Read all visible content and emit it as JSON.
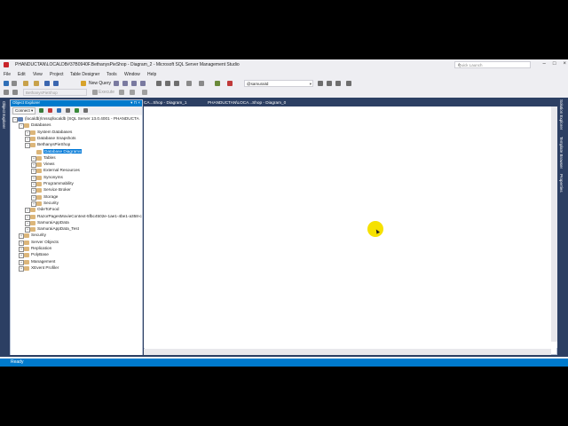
{
  "window": {
    "title": "PHANDUCTAN\\LOCALDB#37B0940F.BethanysPieShop - Diagram_2 - Microsoft SQL Server Management Studio",
    "quick_launch_placeholder": "Quick Launch"
  },
  "menu": [
    "File",
    "Edit",
    "View",
    "Project",
    "Table Designer",
    "Tools",
    "Window",
    "Help"
  ],
  "toolbar": {
    "new_query": "New Query",
    "db_selector": "@samuraiId",
    "db_combo": "BethanysPieShop",
    "execute": "Execute"
  },
  "object_explorer": {
    "title": "Object Explorer",
    "pin": "▾ ⊓ ×",
    "connect": "Connect ▾",
    "nodes": [
      {
        "label": "(localdb)\\mssqllocaldb (SQL Server 13.0.4001 - PHANDUCTA",
        "exp": "−",
        "indent": 0
      },
      {
        "label": "Databases",
        "exp": "−",
        "indent": 1
      },
      {
        "label": "System Databases",
        "exp": "+",
        "indent": 2
      },
      {
        "label": "Database Snapshots",
        "exp": "+",
        "indent": 2
      },
      {
        "label": "BethanysPieShop",
        "exp": "−",
        "indent": 2
      },
      {
        "label": "Database Diagrams",
        "exp": "",
        "indent": 3,
        "selected": true
      },
      {
        "label": "Tables",
        "exp": "+",
        "indent": 3
      },
      {
        "label": "Views",
        "exp": "+",
        "indent": 3
      },
      {
        "label": "External Resources",
        "exp": "+",
        "indent": 3
      },
      {
        "label": "Synonyms",
        "exp": "+",
        "indent": 3
      },
      {
        "label": "Programmability",
        "exp": "+",
        "indent": 3
      },
      {
        "label": "Service Broker",
        "exp": "+",
        "indent": 3
      },
      {
        "label": "Storage",
        "exp": "+",
        "indent": 3
      },
      {
        "label": "Security",
        "exp": "+",
        "indent": 3
      },
      {
        "label": "OdeToFood",
        "exp": "+",
        "indent": 2
      },
      {
        "label": "RazorPagesMovieContext-5fbc4502e-1ae1-4be1-a358-c",
        "exp": "+",
        "indent": 2
      },
      {
        "label": "SamuraiAppData",
        "exp": "+",
        "indent": 2
      },
      {
        "label": "SamuraiAppData_Test",
        "exp": "+",
        "indent": 2
      },
      {
        "label": "Security",
        "exp": "+",
        "indent": 1
      },
      {
        "label": "Server Objects",
        "exp": "+",
        "indent": 1
      },
      {
        "label": "Replication",
        "exp": "+",
        "indent": 1
      },
      {
        "label": "PolyBase",
        "exp": "+",
        "indent": 1
      },
      {
        "label": "Management",
        "exp": "+",
        "indent": 1
      },
      {
        "label": "XEvent Profiler",
        "exp": "+",
        "indent": 1
      }
    ]
  },
  "tabs": [
    "CA...Shop - Diagram_1",
    "PHANDUCTAN\\LOCA...Shop - Diagram_0"
  ],
  "right_rail": [
    "Solution Explorer",
    "Template Browser",
    "Properties"
  ],
  "left_rail": "Object Explorer",
  "status": "Ready",
  "colors": {
    "accent": "#007acc",
    "chrome": "#2c3f63",
    "selection": "#0078d7"
  }
}
